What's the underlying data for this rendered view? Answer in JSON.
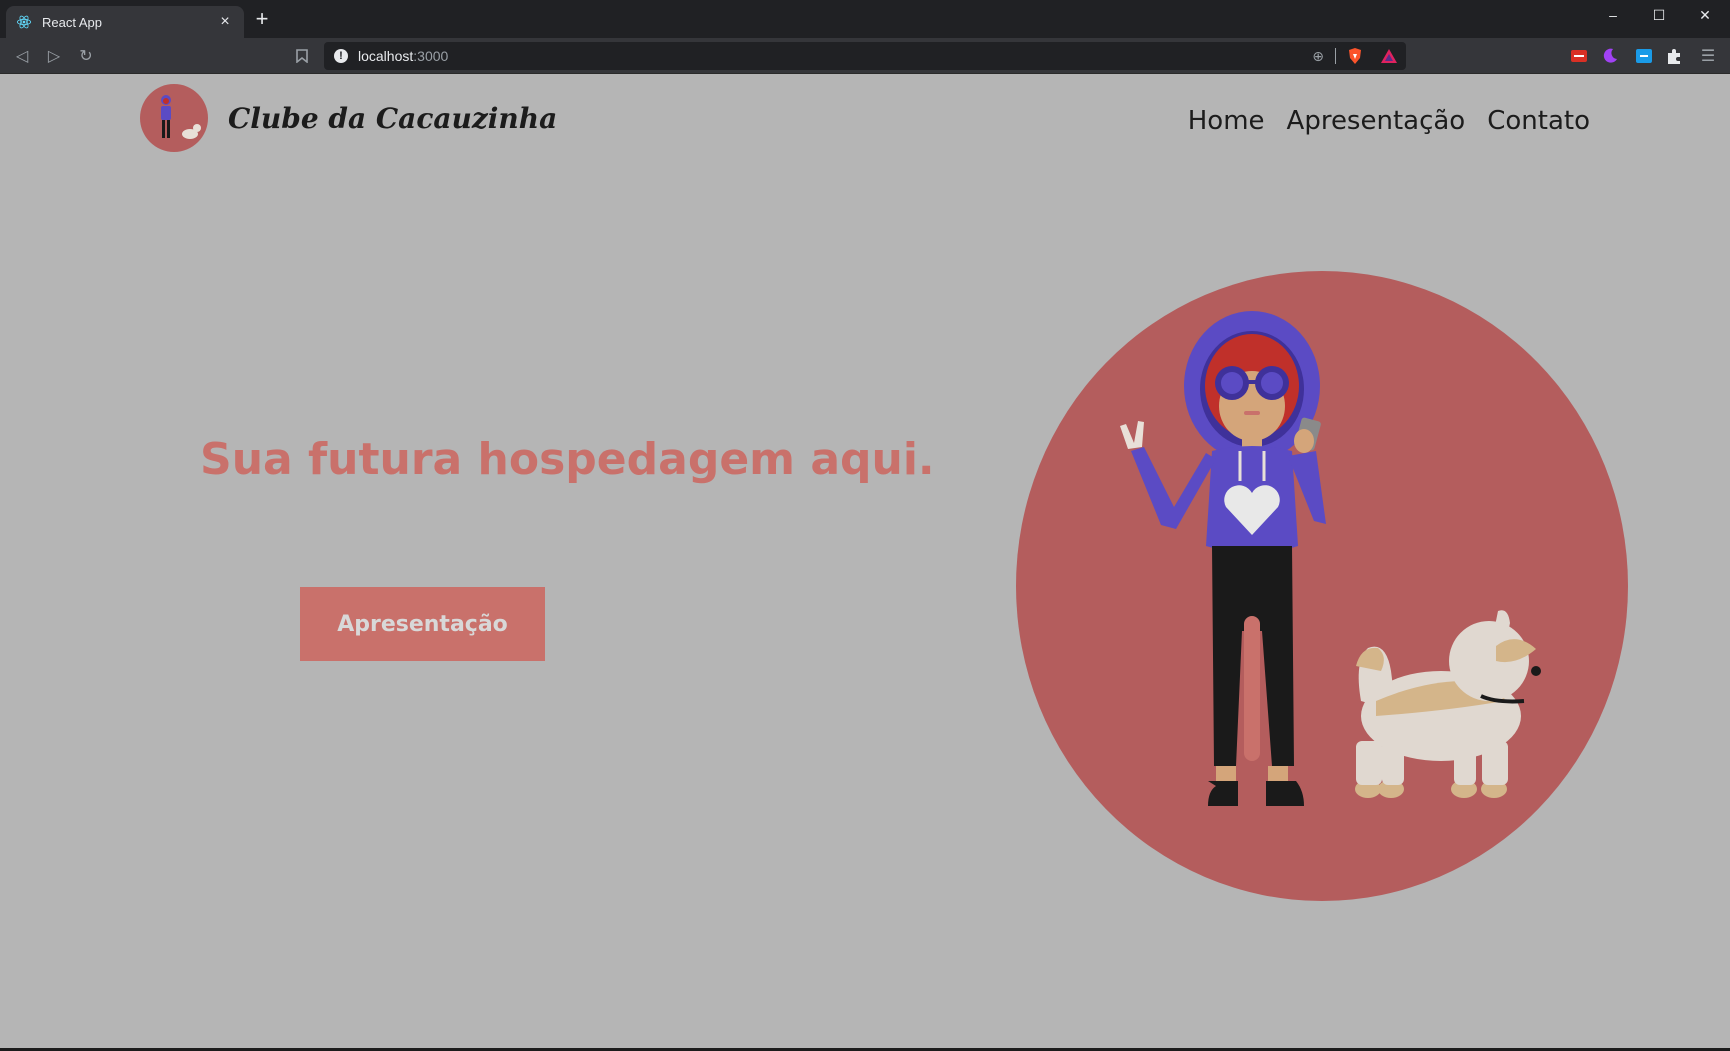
{
  "browser": {
    "tab_title": "React App",
    "tab_close": "×",
    "new_tab": "+",
    "url_host": "localhost",
    "url_port": ":3000",
    "window_controls": {
      "minimize": "–",
      "maximize": "☐",
      "close": "✕"
    },
    "nav_icons": {
      "back": "◁",
      "forward": "▷",
      "reload": "↻",
      "bookmark": "bookmark-icon"
    }
  },
  "site": {
    "brand": "Clube da Cacauzinha",
    "nav": [
      "Home",
      "Apresentação",
      "Contato"
    ]
  },
  "hero": {
    "headline": "Sua futura hospedagem aqui.",
    "button_label": "Apresentação"
  },
  "colors": {
    "page_bg": "#b5b5b5",
    "accent": "#c9716b",
    "circle": "#b45d5d",
    "hoodie": "#5b4bc4",
    "hair": "#c0302a"
  }
}
